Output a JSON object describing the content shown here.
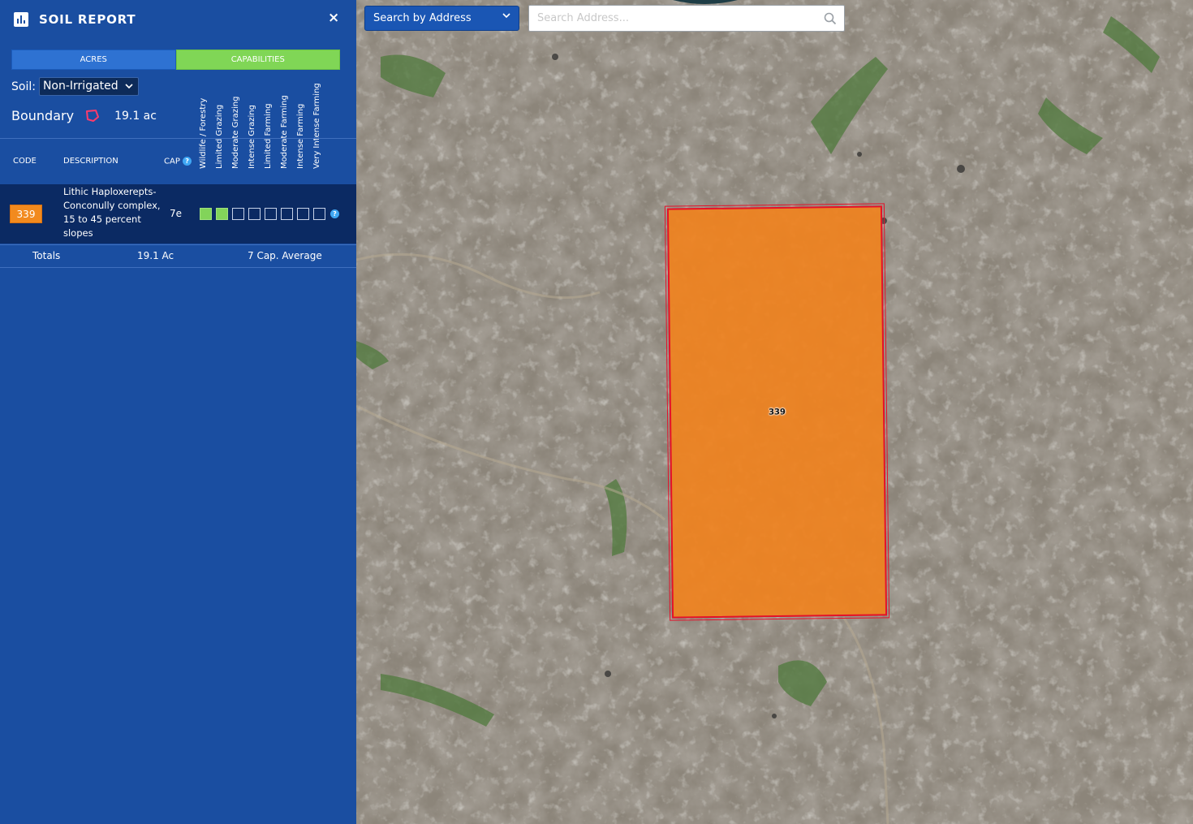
{
  "panel": {
    "title": "SOIL REPORT",
    "close_glyph": "×",
    "tabs": [
      {
        "label": "ACRES",
        "active": false
      },
      {
        "label": "CAPABILITIES",
        "active": true
      }
    ],
    "soil_label": "Soil:",
    "soil_selected": "Non-Irrigated",
    "boundary_label": "Boundary",
    "boundary_acres": "19.1 ac",
    "capability_headers": [
      "Wildlife / Forestry",
      "Limited Grazing",
      "Moderate Grazing",
      "Intense Grazing",
      "Limited Farming",
      "Moderate Farming",
      "Intense Farming",
      "Very Intense Farming"
    ],
    "columns": {
      "code": "CODE",
      "description": "DESCRIPTION",
      "cap": "CAP"
    },
    "rows": [
      {
        "code": "339",
        "description": "Lithic Haploxerepts-Conconully complex, 15 to 45 percent slopes",
        "cap": "7e",
        "filled_boxes": 2,
        "total_boxes": 8
      }
    ],
    "totals": {
      "label": "Totals",
      "acres": "19.1 Ac",
      "average": "7 Cap. Average"
    }
  },
  "map": {
    "search_mode": "Search by Address",
    "search_placeholder": "Search Address...",
    "parcel_label": "339"
  },
  "colors": {
    "panel_bg": "#1a4ea1",
    "row_bg": "#0b2a63",
    "capabilities_tab": "#80d656",
    "parcel_fill": "#f0821e",
    "parcel_border": "#e3122a"
  }
}
